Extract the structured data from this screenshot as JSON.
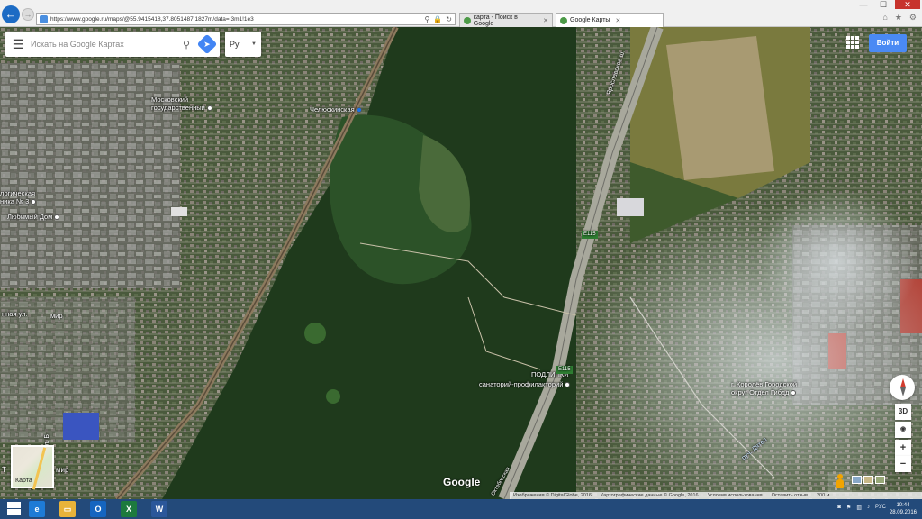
{
  "browser": {
    "url": "https://www.google.ru/maps/@55.9415418,37.8051487,1827m/data=!3m1!1e3",
    "tabs": [
      {
        "title": "карта - Поиск в Google",
        "active": false
      },
      {
        "title": "Google Карты",
        "active": true
      }
    ],
    "window_controls": {
      "minimize": "—",
      "maximize": "☐",
      "close": "✕"
    }
  },
  "maps": {
    "search_placeholder": "Искать на Google Картах",
    "language": "Ру",
    "sign_in": "Войти",
    "labels": {
      "moskovsky": "Московский\nгосударственный",
      "chelyuskinskaya": "Челюскинская",
      "logicheskaya": "логическая\nника № 3",
      "lyubimy_dom": "Любимый Дом",
      "podlipki": "ПОДЛИПКИ",
      "sanatoriy": "санаторий-профилакторий",
      "korolev": "г. Королёв Городской\nокруг Отдел Гибдд",
      "yaroslavskoe": "Ярославское ш.",
      "e115": "E115",
      "ruch_dyatel": "руч. Дятел",
      "ul_text": "нная ул.",
      "ter_text": "Т",
      "mir_text": "мир",
      "ul_vert": "ул. Б",
      "oktyabr": "Октябрьская"
    },
    "controls": {
      "three_d": "3D",
      "zoom_in": "+",
      "zoom_out": "−",
      "locate": "◉"
    },
    "minimap_label": "Карта",
    "logo": "Google",
    "footer": {
      "imagery": "Изображения © DigitalGlobe, 2016",
      "mapdata": "Картографические данные © Google, 2016",
      "terms": "Условия использования",
      "feedback": "Оставить отзыв",
      "scale": "200 м"
    }
  },
  "taskbar": {
    "apps": [
      "Internet Explorer",
      "File Explorer",
      "Outlook",
      "Excel",
      "Word"
    ],
    "language": "РУС",
    "time": "10:44",
    "date": "28.09.2016"
  },
  "colors": {
    "accent": "#4285f4",
    "taskbar": "#234a7a",
    "close": "#c7332c"
  }
}
